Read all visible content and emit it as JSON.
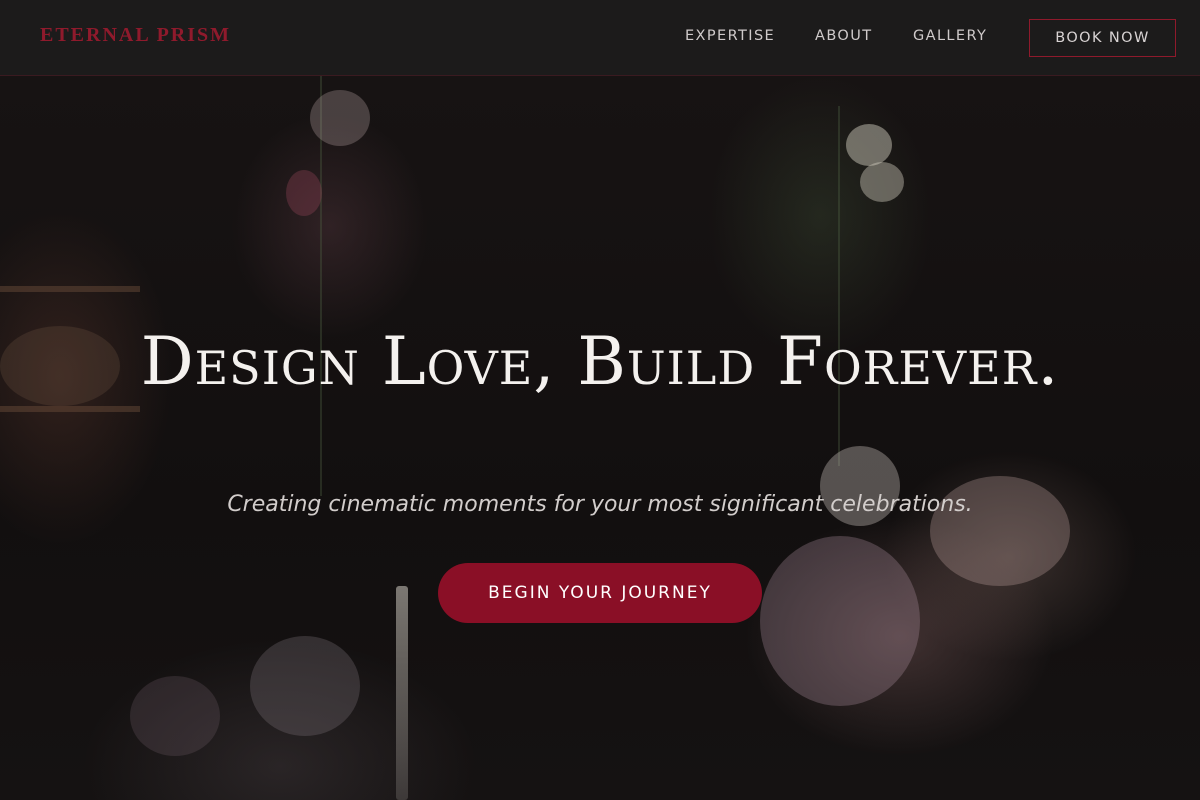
{
  "brand": {
    "name": "ETERNAL PRISM",
    "accent_color": "#8a0f26"
  },
  "nav": {
    "links": [
      {
        "label": "EXPERTISE"
      },
      {
        "label": "ABOUT"
      },
      {
        "label": "GALLERY"
      }
    ],
    "cta_label": "BOOK NOW"
  },
  "hero": {
    "headline": "Design Love, Build Forever.",
    "subheadline": "Creating cinematic moments for your most significant celebrations.",
    "cta_label": "BEGIN YOUR JOURNEY",
    "background": "dark floral arrangement photo"
  }
}
